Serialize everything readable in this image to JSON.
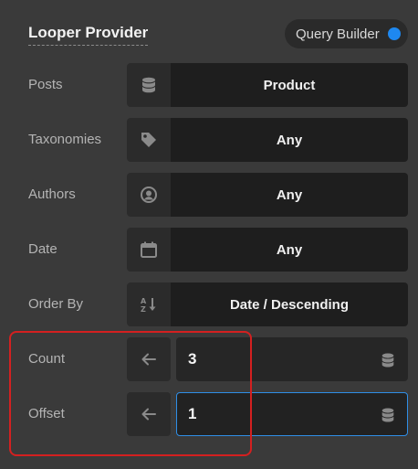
{
  "header": {
    "title": "Looper Provider",
    "query_builder_label": "Query Builder",
    "query_builder_on": true
  },
  "colors": {
    "accent": "#1e88f0",
    "highlight": "#d42020",
    "focus_border": "#2f8ee6"
  },
  "rows": {
    "posts": {
      "label": "Posts",
      "icon": "database-icon",
      "value": "Product"
    },
    "taxonomies": {
      "label": "Taxonomies",
      "icon": "tag-icon",
      "value": "Any"
    },
    "authors": {
      "label": "Authors",
      "icon": "user-circle-icon",
      "value": "Any"
    },
    "date": {
      "label": "Date",
      "icon": "calendar-icon",
      "value": "Any"
    },
    "order_by": {
      "label": "Order By",
      "icon": "sort-az-icon",
      "value": "Date / Descending"
    },
    "count": {
      "label": "Count",
      "icon": "arrow-left-icon",
      "value": "3"
    },
    "offset": {
      "label": "Offset",
      "icon": "arrow-left-icon",
      "value": "1"
    }
  }
}
